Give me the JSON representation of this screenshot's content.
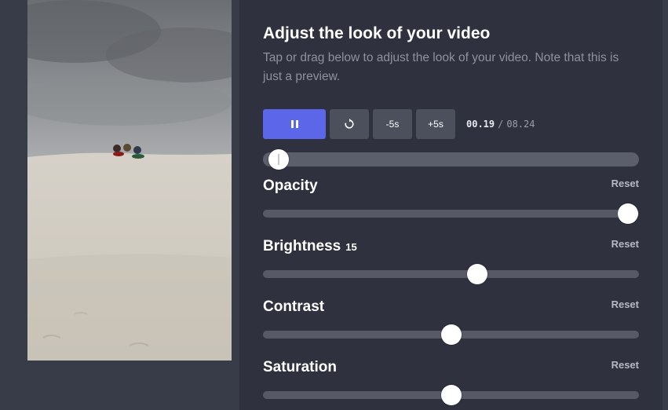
{
  "editor": {
    "title": "Adjust the look of your video",
    "subtitle": "Tap or drag below to adjust the look of your video. Note that this is just a preview."
  },
  "player": {
    "play_state": "playing",
    "restart_icon": "restart-icon",
    "back_label": "-5s",
    "forward_label": "+5s",
    "current_time": "00.19",
    "separator": "/",
    "total_time": "08.24",
    "progress_fraction": 0.02
  },
  "adjustments": {
    "opacity": {
      "label": "Opacity",
      "value": "",
      "reset_label": "Reset",
      "level": 0.97
    },
    "brightness": {
      "label": "Brightness",
      "value": "15",
      "reset_label": "Reset",
      "level": 0.57
    },
    "contrast": {
      "label": "Contrast",
      "value": "",
      "reset_label": "Reset",
      "level": 0.5
    },
    "saturation": {
      "label": "Saturation",
      "value": "",
      "reset_label": "Reset",
      "level": 0.5
    }
  },
  "colors": {
    "accent": "#5b66e8",
    "panel_bg": "#2f323e",
    "page_bg": "#383c48"
  }
}
